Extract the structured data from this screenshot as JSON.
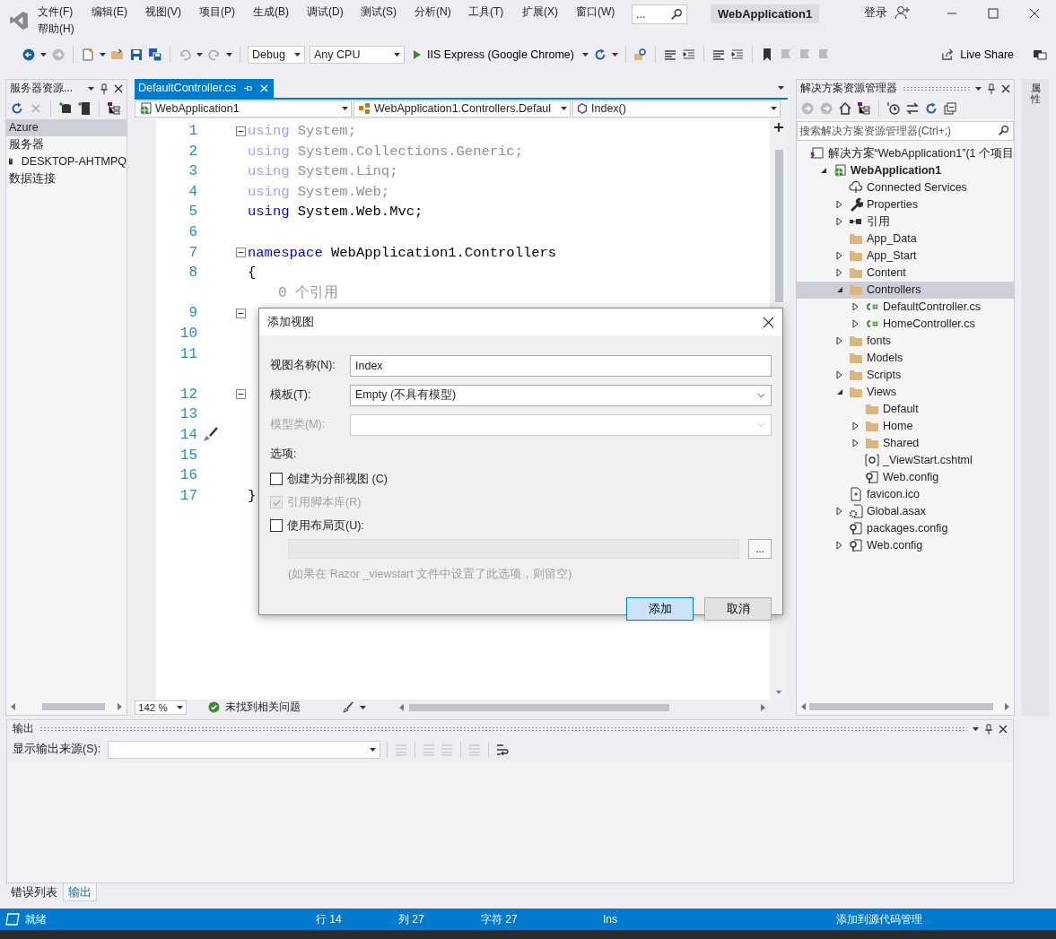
{
  "window": {
    "title": "WebApplication1"
  },
  "menu": [
    "文件(F)",
    "编辑(E)",
    "视图(V)",
    "项目(P)",
    "生成(B)",
    "调试(D)",
    "测试(S)",
    "分析(N)",
    "工具(T)",
    "扩展(X)",
    "窗口(W)",
    "帮助(H)"
  ],
  "search": {
    "value": "..."
  },
  "account": {
    "label": "登录"
  },
  "toolbar": {
    "configuration": "Debug",
    "platform": "Any CPU",
    "run_target": "IIS Express (Google Chrome)",
    "live_share": "Live Share"
  },
  "server_explorer": {
    "title": "服务器资源...",
    "items": [
      {
        "label": "Azure",
        "selected": true,
        "kind": "plain"
      },
      {
        "label": "服务器",
        "selected": false,
        "kind": "plain"
      },
      {
        "label": "DESKTOP-AHTMPQ",
        "selected": false,
        "kind": "server"
      },
      {
        "label": "数据连接",
        "selected": false,
        "kind": "plain"
      }
    ]
  },
  "editor": {
    "tab": {
      "label": "DefaultController.cs"
    },
    "nav": [
      "WebApplication1",
      "WebApplication1.Controllers.Defaul",
      "Index()"
    ],
    "lines": [
      {
        "kind": "code",
        "number": "1",
        "fold": true,
        "faded": true,
        "code": [
          {
            "kind": "keyword",
            "text": "using"
          },
          {
            "kind": "plain",
            "text": " System;"
          }
        ]
      },
      {
        "kind": "code",
        "number": "2",
        "fold": false,
        "faded": true,
        "code": [
          {
            "kind": "keyword",
            "text": "using"
          },
          {
            "kind": "plain",
            "text": " System.Collections.Generic;"
          }
        ]
      },
      {
        "kind": "code",
        "number": "3",
        "fold": false,
        "faded": true,
        "code": [
          {
            "kind": "keyword",
            "text": "using"
          },
          {
            "kind": "plain",
            "text": " System.Linq;"
          }
        ]
      },
      {
        "kind": "code",
        "number": "4",
        "fold": false,
        "faded": true,
        "code": [
          {
            "kind": "keyword",
            "text": "using"
          },
          {
            "kind": "plain",
            "text": " System.Web;"
          }
        ]
      },
      {
        "kind": "code",
        "number": "5",
        "fold": false,
        "faded": false,
        "code": [
          {
            "kind": "keyword",
            "text": "using"
          },
          {
            "kind": "plain",
            "text": " System.Web.Mvc;"
          }
        ]
      },
      {
        "kind": "code",
        "number": "6",
        "fold": false
      },
      {
        "kind": "code",
        "number": "7",
        "fold": true,
        "faded": false,
        "code": [
          {
            "kind": "keyword",
            "text": "namespace"
          },
          {
            "kind": "plain",
            "text": " WebApplication1.Controllers"
          }
        ]
      },
      {
        "kind": "code",
        "number": "8",
        "fold": false,
        "faded": false,
        "code": [
          {
            "kind": "plain",
            "text": "{"
          }
        ]
      },
      {
        "kind": "lens",
        "text": "0 个引用"
      },
      {
        "kind": "code",
        "number": "9",
        "fold": true
      },
      {
        "kind": "code",
        "number": "10",
        "fold": false
      },
      {
        "kind": "code",
        "number": "11",
        "fold": false
      },
      {
        "kind": "gap"
      },
      {
        "kind": "code",
        "number": "12",
        "fold": true
      },
      {
        "kind": "code",
        "number": "13",
        "fold": false
      },
      {
        "kind": "code",
        "number": "14",
        "fold": false,
        "quick_action": true
      },
      {
        "kind": "code",
        "number": "15",
        "fold": false
      },
      {
        "kind": "code",
        "number": "16",
        "fold": false
      },
      {
        "kind": "code",
        "number": "17",
        "fold": false,
        "faded": false,
        "code": [
          {
            "kind": "plain",
            "text": "}"
          }
        ]
      }
    ],
    "zoom": "142 %",
    "issues": "未找到相关问题"
  },
  "solution_explorer": {
    "title": "解决方案资源管理器",
    "search": {
      "placeholder": "搜索解决方案资源管理器(Ctrl+;)"
    },
    "tree": [
      {
        "label": "解决方案“WebApplication1”(1 个项目",
        "kind": "solution",
        "selected": false,
        "children": [
          {
            "label": "WebApplication1",
            "kind": "project",
            "expanded": true,
            "selected": false,
            "children": [
              {
                "label": "Connected Services",
                "kind": "cloud",
                "selected": false
              },
              {
                "label": "Properties",
                "kind": "wrench",
                "expanded": false,
                "selected": false
              },
              {
                "label": "引用",
                "kind": "references",
                "expanded": false,
                "selected": false
              },
              {
                "label": "App_Data",
                "kind": "folder",
                "selected": false
              },
              {
                "label": "App_Start",
                "kind": "folder",
                "expanded": false,
                "selected": false
              },
              {
                "label": "Content",
                "kind": "folder",
                "expanded": false,
                "selected": false
              },
              {
                "label": "Controllers",
                "kind": "folder",
                "expanded": true,
                "selected": true,
                "children": [
                  {
                    "label": "DefaultController.cs",
                    "kind": "csharp",
                    "expanded": false,
                    "selected": false
                  },
                  {
                    "label": "HomeController.cs",
                    "kind": "csharp",
                    "expanded": false,
                    "selected": false
                  }
                ]
              },
              {
                "label": "fonts",
                "kind": "folder",
                "expanded": false,
                "selected": false
              },
              {
                "label": "Models",
                "kind": "folder",
                "selected": false
              },
              {
                "label": "Scripts",
                "kind": "folder",
                "expanded": false,
                "selected": false
              },
              {
                "label": "Views",
                "kind": "folder",
                "expanded": true,
                "selected": false,
                "children": [
                  {
                    "label": "Default",
                    "kind": "folder",
                    "selected": false
                  },
                  {
                    "label": "Home",
                    "kind": "folder",
                    "expanded": false,
                    "selected": false
                  },
                  {
                    "label": "Shared",
                    "kind": "folder",
                    "expanded": false,
                    "selected": false
                  },
                  {
                    "label": "_ViewStart.cshtml",
                    "kind": "razor",
                    "selected": false
                  },
                  {
                    "label": "Web.config",
                    "kind": "config",
                    "selected": false
                  }
                ]
              },
              {
                "label": "favicon.ico",
                "kind": "file",
                "selected": false
              },
              {
                "label": "Global.asax",
                "kind": "asax",
                "expanded": false,
                "selected": false
              },
              {
                "label": "packages.config",
                "kind": "config",
                "selected": false
              },
              {
                "label": "Web.config",
                "kind": "config",
                "expanded": false,
                "selected": false
              }
            ]
          }
        ]
      }
    ]
  },
  "right_strip": {
    "tab": "属性"
  },
  "output": {
    "title": "输出",
    "source_label": "显示输出来源(S):",
    "tabs": [
      {
        "label": "错误列表",
        "selected": false
      },
      {
        "label": "输出",
        "selected": true
      }
    ]
  },
  "status_bar": {
    "items": [
      "就绪",
      "行 14",
      "列 27",
      "字符 27",
      "Ins",
      "添加到源代码管理"
    ]
  },
  "dialog": {
    "title": "添加视图",
    "fields": [
      {
        "label": "视图名称(N):",
        "kind": "text",
        "value": "Index",
        "disabled": false
      },
      {
        "label": "模板(T):",
        "kind": "select",
        "value": "Empty (不具有模型)",
        "disabled": false
      },
      {
        "label": "模型类(M):",
        "kind": "select",
        "disabled": true
      }
    ],
    "options_label": "选项:",
    "options": [
      {
        "label": "创建为分部视图 (C)",
        "checked": false,
        "disabled": false
      },
      {
        "label": "引用脚本库(R)",
        "checked": true,
        "disabled": true
      },
      {
        "label": "使用布局页(U):",
        "checked": false,
        "disabled": false
      }
    ],
    "browse": "...",
    "hint": "(如果在 Razor _viewstart 文件中设置了此选项，则留空)",
    "buttons": [
      {
        "label": "添加",
        "selected": true
      },
      {
        "label": "取消",
        "selected": false
      }
    ]
  }
}
